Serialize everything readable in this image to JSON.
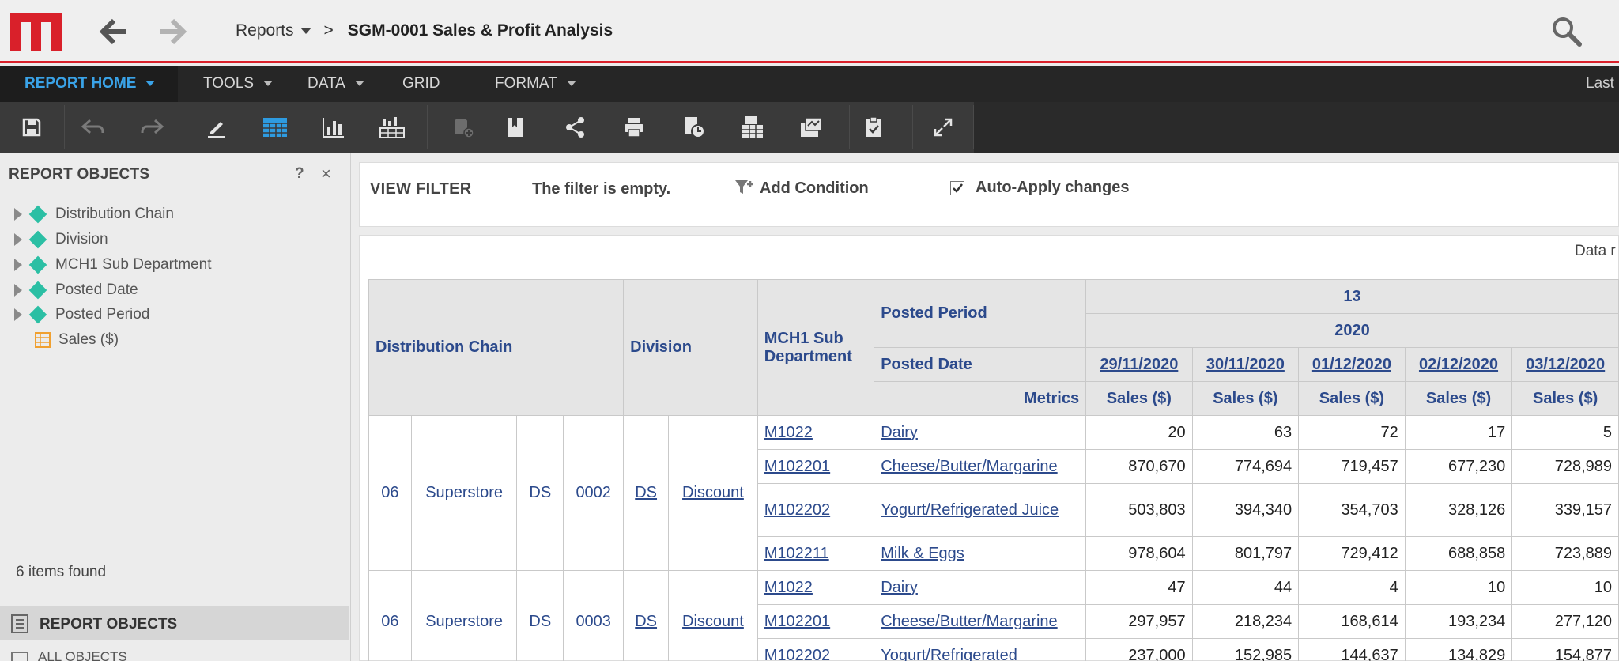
{
  "header": {
    "breadcrumb_root": "Reports",
    "separator": ">",
    "report_title": "SGM-0001 Sales & Profit Analysis"
  },
  "menubar": {
    "items": [
      "REPORT HOME",
      "TOOLS",
      "DATA",
      "GRID",
      "FORMAT"
    ],
    "right_text": "Last"
  },
  "toolbar": {
    "icons": [
      "save-icon",
      "undo-icon",
      "redo-icon",
      "edit-icon",
      "grid-view-icon",
      "graph-view-icon",
      "grid-graph-icon",
      "add-dataset-icon",
      "bookmark-icon",
      "share-icon",
      "print-icon",
      "schedule-icon",
      "export-icon",
      "subscribe-icon",
      "report-options-icon",
      "fullscreen-icon"
    ]
  },
  "left_panel": {
    "title": "REPORT OBJECTS",
    "help": "?",
    "close": "×",
    "objects": [
      {
        "label": "Distribution Chain",
        "kind": "attribute"
      },
      {
        "label": "Division",
        "kind": "attribute"
      },
      {
        "label": "MCH1 Sub Department",
        "kind": "attribute"
      },
      {
        "label": "Posted Date",
        "kind": "attribute"
      },
      {
        "label": "Posted Period",
        "kind": "attribute"
      },
      {
        "label": "Sales ($)",
        "kind": "metric"
      }
    ],
    "count_text": "6 items found",
    "tab_title": "REPORT OBJECTS",
    "all_objects": "ALL OBJECTS"
  },
  "view_filter": {
    "label": "VIEW FILTER",
    "empty_text": "The filter is empty.",
    "add_condition": "Add Condition",
    "auto_apply": "Auto-Apply changes",
    "auto_apply_checked": true
  },
  "grid": {
    "data_note": "Data r",
    "headers": {
      "distribution_chain": "Distribution Chain",
      "division": "Division",
      "mch1": "MCH1 Sub Department",
      "posted_period": "Posted Period",
      "posted_date": "Posted Date",
      "metrics": "Metrics",
      "period_value": "13",
      "year_value": "2020",
      "dates": [
        "29/11/2020",
        "30/11/2020",
        "01/12/2020",
        "02/12/2020",
        "03/12/2020"
      ],
      "metric_name": "Sales ($)"
    },
    "groups": [
      {
        "dc_code": "06",
        "dc_name": "Superstore",
        "div_code": "DS",
        "div_num": "0002",
        "div_link": "DS",
        "div_name": "Discount",
        "rows": [
          {
            "code": "M1022",
            "name": "Dairy",
            "values": [
              "20",
              "63",
              "72",
              "17",
              "5"
            ]
          },
          {
            "code": "M102201",
            "name": "Cheese/Butter/Margarine",
            "values": [
              "870,670",
              "774,694",
              "719,457",
              "677,230",
              "728,989"
            ]
          },
          {
            "code": "M102202",
            "name": "Yogurt/Refrigerated Juice",
            "values": [
              "503,803",
              "394,340",
              "354,703",
              "328,126",
              "339,157"
            ]
          },
          {
            "code": "M102211",
            "name": "Milk & Eggs",
            "values": [
              "978,604",
              "801,797",
              "729,412",
              "688,858",
              "723,889"
            ]
          }
        ]
      },
      {
        "dc_code": "06",
        "dc_name": "Superstore",
        "div_code": "DS",
        "div_num": "0003",
        "div_link": "DS",
        "div_name": "Discount",
        "rows": [
          {
            "code": "M1022",
            "name": "Dairy",
            "values": [
              "47",
              "44",
              "4",
              "10",
              "10"
            ]
          },
          {
            "code": "M102201",
            "name": "Cheese/Butter/Margarine",
            "values": [
              "297,957",
              "218,234",
              "168,614",
              "193,234",
              "277,120"
            ]
          },
          {
            "code": "M102202",
            "name": "Yogurt/Refrigerated",
            "values": [
              "237,000",
              "152,985",
              "144,637",
              "134,829",
              "154,877"
            ]
          }
        ]
      }
    ]
  },
  "colors": {
    "brand_red": "#d9202a",
    "accent_blue": "#3aa3e8",
    "link_blue": "#2c4a8c",
    "attribute_green": "#2bbfa4",
    "metric_orange": "#f0a030"
  }
}
